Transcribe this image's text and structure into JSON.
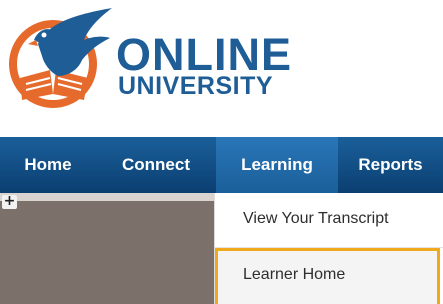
{
  "brand": {
    "line1": "ONLINE",
    "line2": "UNIVERSITY",
    "colors": {
      "primary_blue": "#1f5d96",
      "accent_orange": "#e56a2c"
    },
    "logo_icon": "eagle-book-emblem"
  },
  "nav": {
    "items": [
      {
        "label": "Home"
      },
      {
        "label": "Connect"
      },
      {
        "label": "Learning",
        "active": true
      },
      {
        "label": "Reports"
      }
    ],
    "colors": {
      "bar": "#124d85",
      "active": "#2a76b8",
      "text": "#ffffff"
    }
  },
  "content": {
    "expand_glyph": "+",
    "expand_icon": "plus-icon"
  },
  "dropdown": {
    "items": [
      {
        "label": "View Your Transcript"
      },
      {
        "label": "Learner Home",
        "highlighted": true
      }
    ],
    "highlight_color": "#f0a81c"
  }
}
